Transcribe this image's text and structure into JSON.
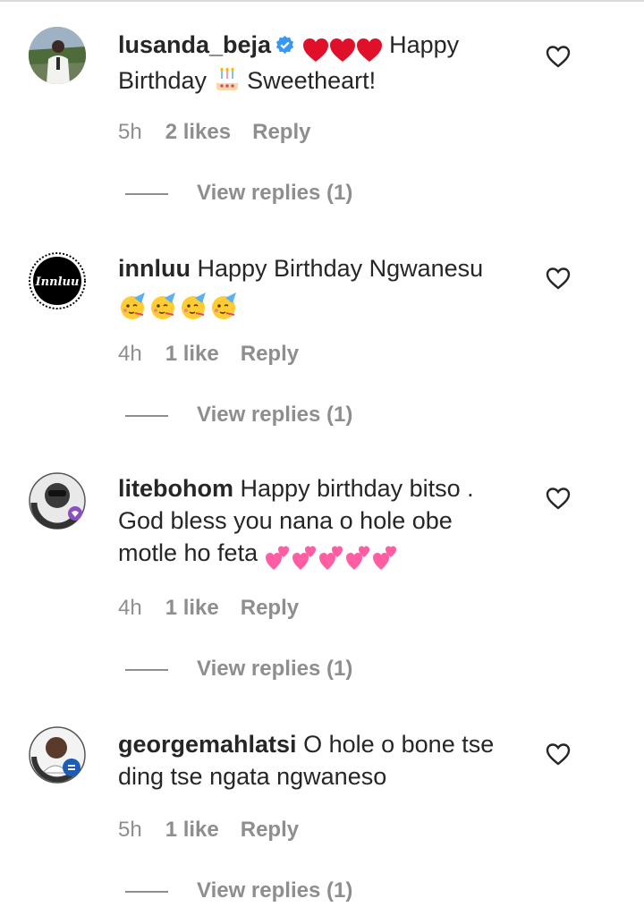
{
  "comments": [
    {
      "username": "lusanda_beja",
      "verified": true,
      "text_before": "Happy Birthday",
      "text_after": "Sweetheart!",
      "time": "5h",
      "likes": "2 likes",
      "reply": "Reply",
      "view_replies": "View replies (1)",
      "avatar_icon": "person-in-white-suit-avatar",
      "emojis_lead": [
        "red-heart-emoji",
        "red-heart-emoji",
        "red-heart-emoji"
      ],
      "emoji_inline": "birthday-cake-emoji"
    },
    {
      "username": "innluu",
      "text": "Happy Birthday Ngwanesu",
      "time": "4h",
      "likes": "1 like",
      "reply": "Reply",
      "view_replies": "View replies (1)",
      "avatar_logo_text": "Innluu",
      "emojis": [
        "partying-face-emoji",
        "partying-face-emoji",
        "partying-face-emoji",
        "partying-face-emoji"
      ]
    },
    {
      "username": "litebohom",
      "text": "Happy birthday bitso . God bless you nana o hole obe motle ho feta",
      "time": "4h",
      "likes": "1 like",
      "reply": "Reply",
      "view_replies": "View replies (1)",
      "avatar_badge_text": "I GOT MY COVID-19 VACCINE",
      "emojis": [
        "two-hearts-emoji",
        "two-hearts-emoji",
        "two-hearts-emoji",
        "two-hearts-emoji",
        "two-hearts-emoji"
      ]
    },
    {
      "username": "georgemahlatsi",
      "text": "O hole o bone tse ding tse ngata ngwaneso",
      "time": "5h",
      "likes": "1 like",
      "reply": "Reply",
      "view_replies": "View replies (1)",
      "avatar_badge_text": "I GOT MY COVID-19 VACCINE"
    }
  ],
  "colors": {
    "text": "#262626",
    "meta": "#8e8e8e",
    "verified": "#3897f0",
    "heart_red": "#e0102a",
    "pink": "#ff5fa2"
  }
}
